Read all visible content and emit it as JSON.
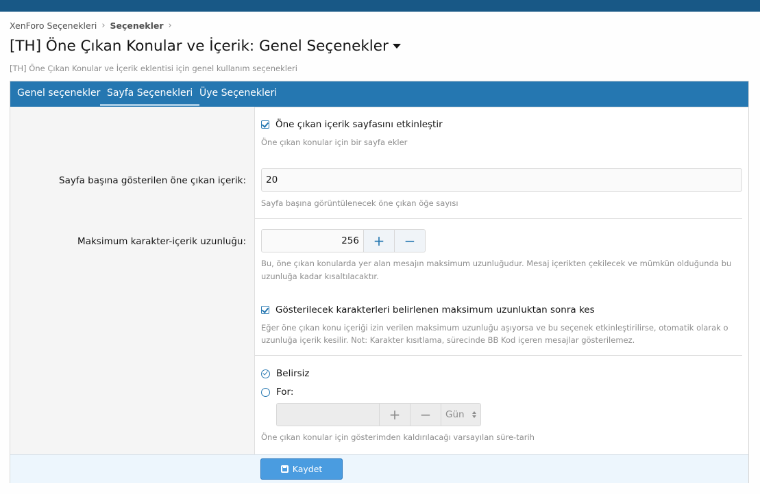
{
  "breadcrumb": {
    "items": [
      "XenForo Seçenekleri",
      "Seçenekler"
    ]
  },
  "page": {
    "title": "[TH] Öne Çıkan Konular ve İçerik: Genel Seçenekler",
    "description": "[TH] Öne Çıkan Konular ve İçerik eklentisi için genel kullanım seçenekleri"
  },
  "tabs": [
    {
      "label": "Genel seçenekler",
      "active": false
    },
    {
      "label": "Sayfa Seçenekleri",
      "active": true
    },
    {
      "label": "Üye Seçenekleri",
      "active": false
    }
  ],
  "options": {
    "enable_page": {
      "label": "Öne çıkan içerik sayfasını etkinleştir",
      "checked": true,
      "hint": "Öne çıkan konular için bir sayfa ekler"
    },
    "per_page": {
      "label": "Sayfa başına gösterilen öne çıkan içerik:",
      "value": "20",
      "hint": "Sayfa başına görüntülenecek öne çıkan öğe sayısı"
    },
    "max_length": {
      "label": "Maksimum karakter-içerik uzunluğu:",
      "value": "256",
      "plus": "+",
      "minus": "−",
      "hint_line1": "Bu, öne çıkan konularda yer alan mesajın maksimum uzunluğudur. Mesaj içerikten çekilecek ve mümkün olduğunda bu",
      "hint_line2": "uzunluğa kadar kısaltılacaktır."
    },
    "truncate": {
      "label": "Gösterilecek karakterleri belirlenen maksimum uzunluktan sonra kes",
      "checked": true,
      "hint_line1": "Eğer öne çıkan konu içeriği izin verilen maksimum uzunluğu aşıyorsa ve bu seçenek etkinleştirilirse, otomatik olarak o",
      "hint_line2": "uzunluğa içerik kesilir. Not: Karakter kısıtlama, sürecinde BB Kod içeren mesajlar gösterilemez."
    },
    "expiry": {
      "radio_indefinite": "Belirsiz",
      "radio_for": "For:",
      "selected": "Belirsiz",
      "value": "",
      "plus": "+",
      "minus": "−",
      "unit": "Gün",
      "hint": "Öne çıkan konular için gösterimden kaldırılacağı varsayılan süre-tarih"
    }
  },
  "footer": {
    "save_label": "Kaydet"
  },
  "colors": {
    "accent": "#2577b1",
    "topbar": "#185886",
    "save_button": "#4a9ce0"
  }
}
